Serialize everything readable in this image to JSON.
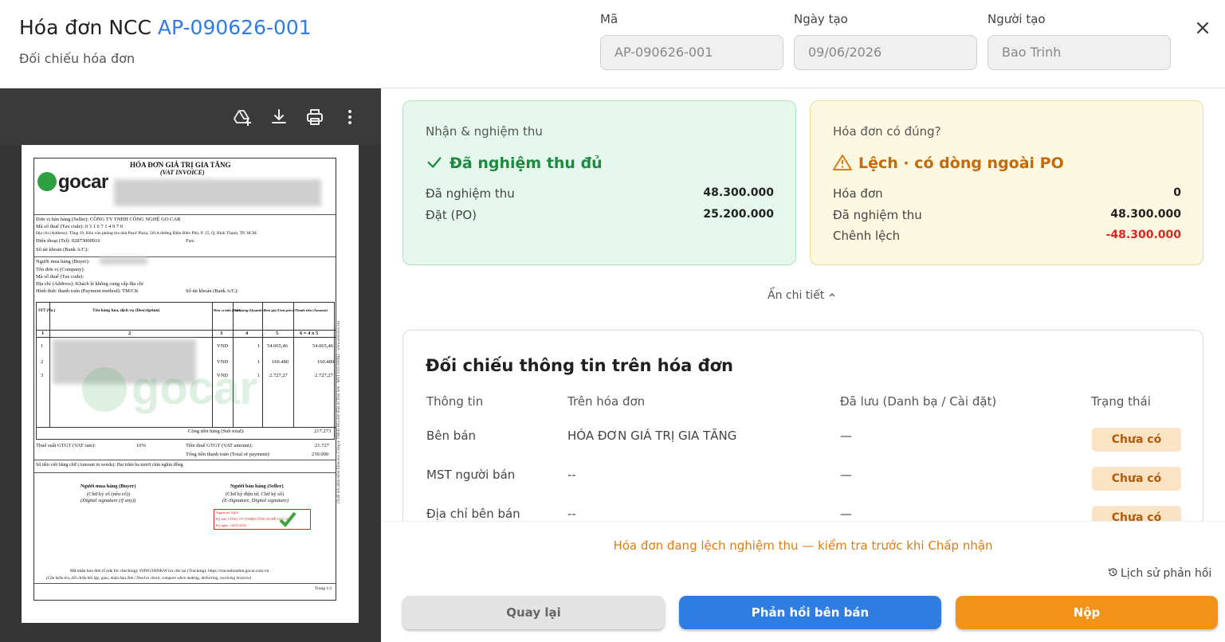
{
  "header": {
    "title_prefix": "Hóa đơn NCC",
    "invoice_code": "AP-090626-001",
    "subtitle": "Đối chiếu hóa đơn",
    "fields": {
      "code_label": "Mã",
      "code_value": "AP-090626-001",
      "date_label": "Ngày tạo",
      "date_value": "09/06/2026",
      "creator_label": "Người tạo",
      "creator_value": "Bao Trinh"
    }
  },
  "viewer": {
    "icons": [
      "drive-add-icon",
      "download-icon",
      "print-icon",
      "more-vert-icon"
    ],
    "invoice": {
      "heading": "HÓA ĐƠN GIÁ TRỊ GIA TĂNG",
      "heading_en": "(VAT INVOICE)",
      "logo": "gocar",
      "seller_line": "Đơn vị bán hàng (Seller): CÔNG TY TNHH CÔNG NGHỆ GO CAR",
      "tax_line": "Mã số thuế (Tax code): 0 3 1 6 7 1 4 9 7 0",
      "address_line": "Địa chỉ (Address): Tầng 19, Khu văn phòng tòa nhà Pearl Plaza, 561A đường Điện Biên Phủ, P. 25, Q. Bình Thạnh, TP. HCM.",
      "phone_line": "Điện thoại (Tel): 02873000916",
      "fax_label": "Fax:",
      "bank_line": "Số tài khoản (Bank A/C):",
      "buyer_line": "Người mua hàng (Buyer):",
      "company_line": "Tên đơn vị (Company):",
      "buyer_tax_line": "Mã số thuế (Tax code):",
      "buyer_address_line": "Địa chỉ (Address): Khách lẻ không cung cấp địa chỉ",
      "payment_line": "Hình thức thanh toán (Payment method): TM/CK",
      "buyer_bank_line": "Số tài khoản (Bank A/C):",
      "col_headers": [
        "STT (No.)",
        "Tên hàng hóa, dịch vụ (Description)",
        "Đơn vị tính (Unit)",
        "Số lượng (Quantity)",
        "Đơn giá (Unit price)",
        "Thành tiền (Amount)"
      ],
      "col_index": [
        "1",
        "2",
        "3",
        "4",
        "5",
        "6 = 4 x 5"
      ],
      "rows": [
        {
          "no": "1",
          "unit": "VND",
          "qty": "1",
          "price": "54.065,46",
          "amount": "54.065,46"
        },
        {
          "no": "2",
          "unit": "VND",
          "qty": "1",
          "price": "160.480",
          "amount": "160.480"
        },
        {
          "no": "3",
          "unit": "VND",
          "qty": "1",
          "price": "2.727,27",
          "amount": "2.727,27"
        }
      ],
      "subtotal_label": "Cộng tiền hàng (Sub total):",
      "subtotal": "217.273",
      "vat_rate_label": "Thuế suất GTGT (VAT rate):",
      "vat_rate": "10%",
      "vat_amount_label": "Tiền thuế GTGT (VAT amount):",
      "vat_amount": "21.727",
      "total_label": "Tổng tiền thanh toán (Total of payment):",
      "total": "239.000",
      "words_line": "Số tiền viết bằng chữ (Amount in words): Hai trăm ba mươi chín nghìn đồng",
      "buyer_sign": "Người mua hàng (Buyer)",
      "buyer_sign_sub": "(Chữ ký số (nếu có))",
      "buyer_sign_en": "(Digital signature (if any))",
      "seller_sign": "Người bán hàng (Seller)",
      "seller_sign_sub": "(Chữ ký điện tử, Chữ ký số)",
      "seller_sign_en": "(E-Signature, Digital signature)",
      "sig_valid": "Signature Valid",
      "sig_by": "Ký bởi: CÔNG TY TNHH CÔNG NGHỆ GO CAR",
      "sig_date": "Ký ngày: 14/01/2021",
      "lookup_line": "Mã nhận hóa đơn (Code for checking): FHW21HNKW  tra cứu tại (Tracking): https://tracuuhoadon.gocar.com.vn",
      "check_note": "(Cần kiểm tra, đối chiếu khi lập, giao, nhận hóa đơn / Need to check, compare when making, delivering, receiving invoices)",
      "page_label": "Trang 1/1",
      "side_text": "(Xuất bởi phần mềm EInvoice, Công ty TNHH Hóa đơn điện tử Thái Sơn - MST 0101300842 - www.einvoice.vn)"
    }
  },
  "cards": {
    "receive": {
      "title": "Nhận & nghiệm thu",
      "status": "Đã nghiệm thu đủ",
      "status_color": "#1d8a3f",
      "rows": [
        {
          "label": "Đã nghiệm thu",
          "value": "48.300.000"
        },
        {
          "label": "Đặt (PO)",
          "value": "25.200.000"
        }
      ]
    },
    "invoice_check": {
      "title": "Hóa đơn có đúng?",
      "status": "Lệch · có dòng ngoài PO",
      "status_color": "#c56a06",
      "rows": [
        {
          "label": "Hóa đơn",
          "value": "0"
        },
        {
          "label": "Đã nghiệm thu",
          "value": "48.300.000"
        },
        {
          "label": "Chênh lệch",
          "value": "-48.300.000"
        }
      ],
      "negative_color": "#e02424"
    }
  },
  "toggle_details": "Ẩn chi tiết",
  "reconcile": {
    "title": "Đối chiếu thông tin trên hóa đơn",
    "columns": [
      "Thông tin",
      "Trên hóa đơn",
      "Đã lưu (Danh bạ / Cài đặt)",
      "Trạng thái"
    ],
    "rows": [
      {
        "field": "Bên bán",
        "on_invoice": "HÓA ĐƠN GIÁ TRỊ GIA TĂNG",
        "saved": "—",
        "status": "Chưa có"
      },
      {
        "field": "MST người bán",
        "on_invoice": "--",
        "saved": "—",
        "status": "Chưa có"
      },
      {
        "field": "Địa chỉ bên bán",
        "on_invoice": "--",
        "saved": "—",
        "status": "Chưa có"
      }
    ]
  },
  "footer": {
    "warning": "Hóa đơn đang lệch nghiệm thu — kiểm tra trước khi Chấp nhận",
    "history": "Lịch sử phản hồi",
    "buttons": {
      "back": "Quay lại",
      "reply": "Phản hồi bên bán",
      "submit": "Nộp"
    }
  },
  "colors": {
    "accent_blue": "#2f7de1",
    "accent_orange": "#f39218",
    "success": "#1d8a3f",
    "warning": "#c56a06"
  }
}
